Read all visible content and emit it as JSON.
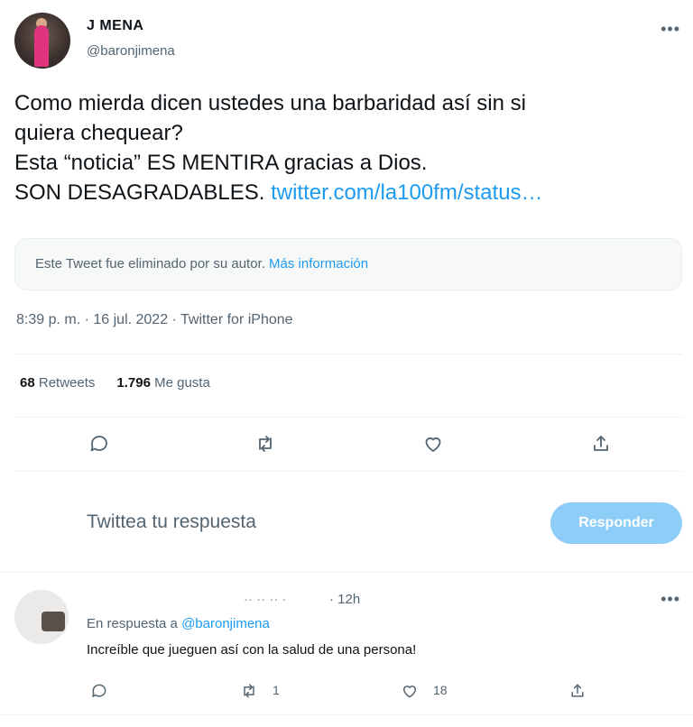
{
  "author": {
    "name": "J MENA",
    "handle": "@baronjimena"
  },
  "tweet": {
    "line1": "Como mierda dicen ustedes una barbaridad así sin si",
    "line2": "quiera chequear?",
    "line3": "Esta “noticia” ES MENTIRA gracias a Dios.",
    "line4_text": "SON DESAGRADABLES. ",
    "line4_link": "twitter.com/la100fm/status…"
  },
  "deleted_notice": {
    "text": "Este Tweet fue eliminado por su autor. ",
    "link": "Más información"
  },
  "meta": "8:39 p. m. · 16 jul. 2022 · Twitter for iPhone",
  "stats": {
    "retweets_count": "68",
    "retweets_label": " Retweets",
    "likes_count": "1.796",
    "likes_label": " Me gusta"
  },
  "compose": {
    "placeholder": "Twittea tu respuesta",
    "button": "Responder"
  },
  "reply": {
    "name": "·· ·· ·· ·",
    "time": "· 12h",
    "in_reply_label": "En respuesta a ",
    "in_reply_handle": "@baronjimena",
    "text": "Increíble que jueguen así con la salud de una persona!",
    "retweets": "1",
    "likes": "18"
  },
  "icons": [
    "more-icon",
    "reply-icon",
    "retweet-icon",
    "like-icon",
    "share-icon"
  ],
  "colors": {
    "accent": "#1d9bf0",
    "button_disabled": "#8ecdf8",
    "secondary_text": "#536471"
  }
}
